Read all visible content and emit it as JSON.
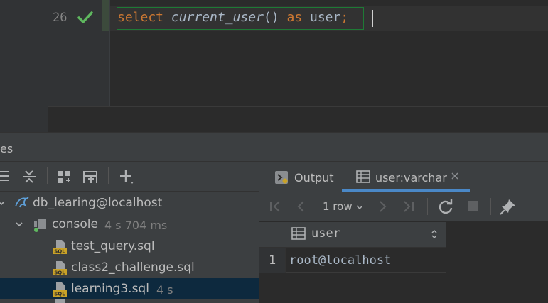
{
  "editor": {
    "line_number": "26",
    "code": {
      "kw_select": "select",
      "fn_current_user": "current_user",
      "parens": "()",
      "kw_as": "as",
      "alias": "user",
      "semicolon": ";"
    }
  },
  "panel": {
    "title": "es"
  },
  "tree": {
    "datasource": "db_learing@localhost",
    "console": {
      "label": "console",
      "meta": "4 s 704 ms"
    },
    "files": [
      {
        "label": "test_query.sql",
        "meta": ""
      },
      {
        "label": "class2_challenge.sql",
        "meta": ""
      },
      {
        "label": "learning3.sql",
        "meta": "4 s"
      }
    ]
  },
  "results": {
    "tabs": {
      "output": "Output",
      "result": "user:varchar"
    },
    "row_count": "1 row",
    "columns": [
      "user"
    ],
    "rows": [
      {
        "num": "1",
        "cells": [
          "root@localhost"
        ]
      }
    ]
  },
  "colors": {
    "accent": "#4a88c7",
    "keyword": "#cc7832",
    "success": "#5fb85f"
  }
}
